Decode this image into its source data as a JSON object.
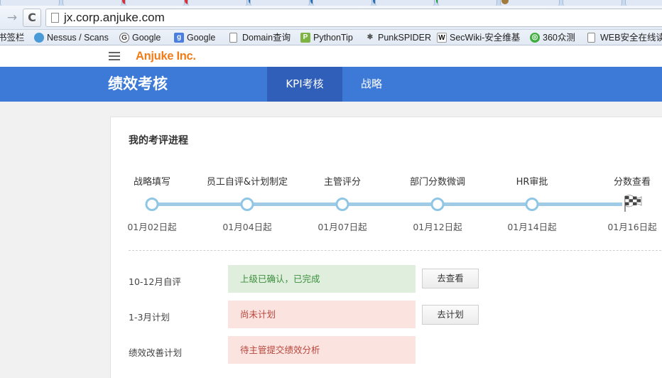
{
  "browser": {
    "url": "jx.corp.anjuke.com",
    "bookmarks": [
      {
        "label": "书签栏",
        "icon": "none"
      },
      {
        "label": "Nessus / Scans",
        "icon": "nessus-icon"
      },
      {
        "label": "Google",
        "icon": "google-icon"
      },
      {
        "label": "Google",
        "icon": "google-g-icon"
      },
      {
        "label": "Domain查询",
        "icon": "page-icon"
      },
      {
        "label": "PythonTip",
        "icon": "pythontip-icon"
      },
      {
        "label": "PunkSPIDER",
        "icon": "spider-icon"
      },
      {
        "label": "SecWiki-安全维基",
        "icon": "wiki-icon"
      },
      {
        "label": "360众测",
        "icon": "360-icon"
      },
      {
        "label": "WEB安全在线读",
        "icon": "page-icon"
      }
    ]
  },
  "site": {
    "brand": "Anjuke Inc.",
    "title": "绩效考核",
    "tabs": [
      {
        "label": "KPI考核",
        "active": true
      },
      {
        "label": "战略",
        "active": false
      }
    ]
  },
  "progress": {
    "title": "我的考评进程",
    "steps": [
      {
        "label": "战略填写",
        "date": "01月02日起"
      },
      {
        "label": "员工自评&计划制定",
        "date": "01月04日起"
      },
      {
        "label": "主管评分",
        "date": "01月07日起"
      },
      {
        "label": "部门分数微调",
        "date": "01月12日起"
      },
      {
        "label": "HR审批",
        "date": "01月14日起"
      },
      {
        "label": "分数查看",
        "date": "01月16日起"
      }
    ]
  },
  "tasks": [
    {
      "label": "10-12月自评",
      "status": "上级已确认，已完成",
      "state": "done",
      "action": "去查看"
    },
    {
      "label": "1-3月计划",
      "status": "尚未计划",
      "state": "pending",
      "action": "去计划"
    },
    {
      "label": "绩效改善计划",
      "status": "待主管提交绩效分析",
      "state": "pending",
      "action": ""
    }
  ],
  "colors": {
    "header_blue": "#3d7ad8",
    "active_tab": "#2f5fb8",
    "brand_orange": "#f07d1a",
    "done_bg": "#dfeedd",
    "pending_bg": "#fbe3e0"
  }
}
